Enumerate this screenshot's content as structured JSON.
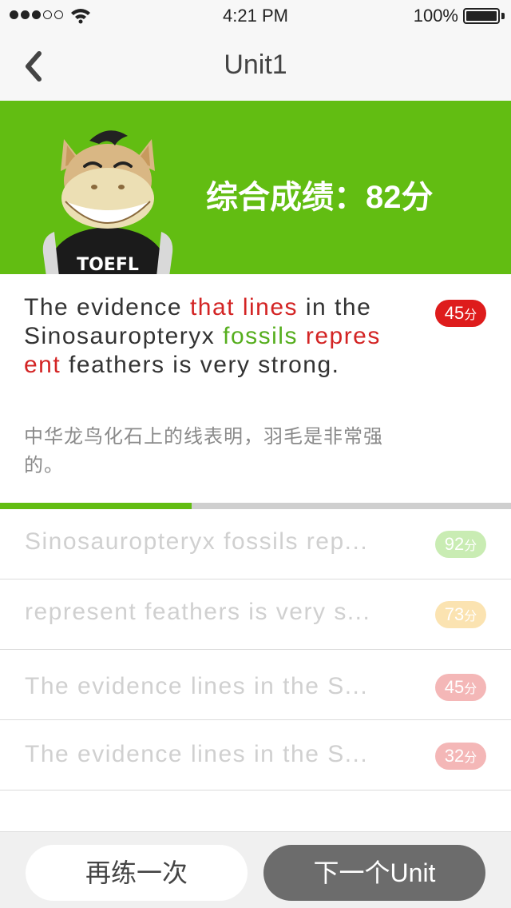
{
  "status_bar": {
    "time": "4:21 PM",
    "battery": "100%"
  },
  "nav": {
    "title": "Unit1"
  },
  "banner": {
    "score_text": "综合成绩：82分",
    "shirt_text": "TOEFL"
  },
  "current": {
    "sentence_parts": [
      {
        "text": "The evidence ",
        "style": "normal"
      },
      {
        "text": "that lines",
        "style": "red"
      },
      {
        "text": " in the Sinosauropteryx ",
        "style": "normal"
      },
      {
        "text": "fossils",
        "style": "green"
      },
      {
        "text": " ",
        "style": "normal"
      },
      {
        "text": "represent",
        "style": "red"
      },
      {
        "text": " feathers is very strong.",
        "style": "normal"
      }
    ],
    "translation": "中华龙鸟化石上的线表明，羽毛是非常强的。",
    "score": "45",
    "score_unit": "分"
  },
  "progress": {
    "fraction": 0.375
  },
  "list": [
    {
      "text": "Sinosauropteryx fossils rep...",
      "score": "92",
      "unit": "分",
      "color": "#c9ecb3"
    },
    {
      "text": "represent feathers is very s...",
      "score": "73",
      "unit": "分",
      "color": "#fbe3b1"
    },
    {
      "text": "The evidence lines in the S...",
      "score": "45",
      "unit": "分",
      "color": "#f4b7b7"
    },
    {
      "text": "The evidence lines in the S...",
      "score": "32",
      "unit": "分",
      "color": "#f4b7b7"
    }
  ],
  "buttons": {
    "retry": "再练一次",
    "next": "下一个Unit"
  },
  "colors": {
    "accent": "#62bd12",
    "score_red": "#de1c1c",
    "highlight_red": "#d32424",
    "highlight_green": "#56ae1e"
  }
}
